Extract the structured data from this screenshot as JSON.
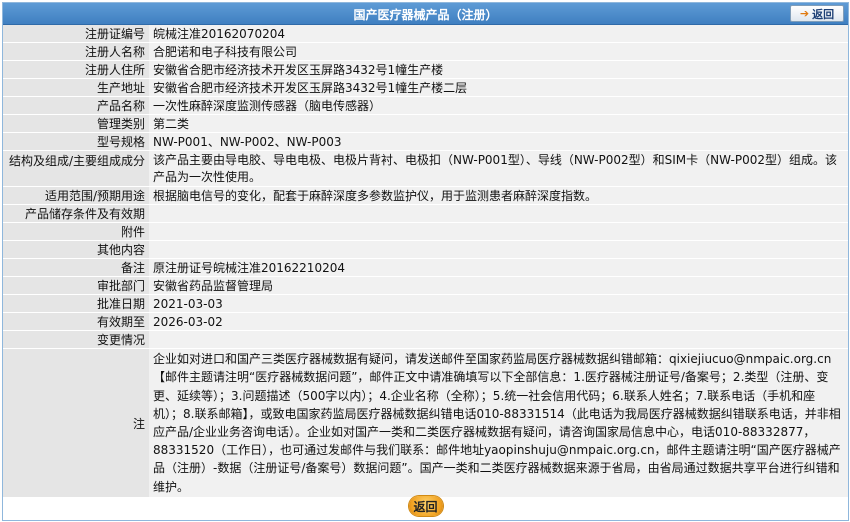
{
  "header": {
    "title": "国产医疗器械产品（注册）",
    "back_label": "返回"
  },
  "rows": [
    {
      "label": "注册证编号",
      "value": "皖械注准20162070204"
    },
    {
      "label": "注册人名称",
      "value": "合肥诺和电子科技有限公司"
    },
    {
      "label": "注册人住所",
      "value": "安徽省合肥市经济技术开发区玉屏路3432号1幢生产楼"
    },
    {
      "label": "生产地址",
      "value": "安徽省合肥市经济技术开发区玉屏路3432号1幢生产楼二层"
    },
    {
      "label": "产品名称",
      "value": "一次性麻醉深度监测传感器（脑电传感器）"
    },
    {
      "label": "管理类别",
      "value": "第二类"
    },
    {
      "label": "型号规格",
      "value": "NW-P001、NW-P002、NW-P003"
    },
    {
      "label": "结构及组成/主要组成成分",
      "value": "该产品主要由导电胶、导电电极、电极片背衬、电极扣（NW-P001型）、导线（NW-P002型）和SIM卡（NW-P002型）组成。该产品为一次性使用。"
    },
    {
      "label": "适用范围/预期用途",
      "value": "根据脑电信号的变化，配套于麻醉深度多参数监护仪，用于监测患者麻醉深度指数。"
    },
    {
      "label": "产品储存条件及有效期",
      "value": ""
    },
    {
      "label": "附件",
      "value": ""
    },
    {
      "label": "其他内容",
      "value": ""
    },
    {
      "label": "备注",
      "value": "原注册证号皖械注准20162210204"
    },
    {
      "label": "审批部门",
      "value": "安徽省药品监督管理局"
    },
    {
      "label": "批准日期",
      "value": "2021-03-03"
    },
    {
      "label": "有效期至",
      "value": "2026-03-02"
    },
    {
      "label": "变更情况",
      "value": ""
    },
    {
      "label": "注",
      "value": "企业如对进口和国产三类医疗器械数据有疑问，请发送邮件至国家药监局医疗器械数据纠错邮箱：qixiejiucuo@nmpaic.org.cn【邮件主题请注明“医疗器械数据问题”，邮件正文中请准确填写以下全部信息：1.医疗器械注册证号/备案号；2.类型（注册、变更、延续等）；3.问题描述（500字以内）；4.企业名称（全称）；5.统一社会信用代码；6.联系人姓名；7.联系电话（手机和座机）；8.联系邮箱】，或致电国家药监局医疗器械数据纠错电话010-88331514（此电话为我局医疗器械数据纠错联系电话，并非相应产品/企业业务咨询电话）。企业如对国产一类和二类医疗器械数据有疑问，请咨询国家局信息中心，电话010-88332877，88331520（工作日），也可通过发邮件与我们联系：邮件地址yaopinshuju@nmpaic.org.cn，邮件主题请注明“国产医疗器械产品（注册）-数据（注册证号/备案号）数据问题”。国产一类和二类医疗器械数据来源于省局，由省局通过数据共享平台进行纠错和维护。"
    }
  ],
  "footer": {
    "back_label": "返回"
  },
  "icons": {
    "back_arrow": "back-arrow-icon"
  }
}
